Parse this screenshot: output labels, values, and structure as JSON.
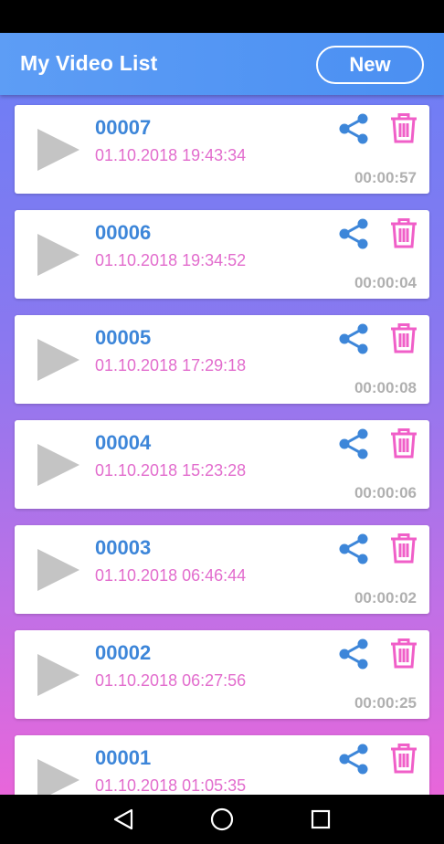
{
  "app": {
    "title": "My Video List",
    "new_label": "New"
  },
  "videos": [
    {
      "name": "00007",
      "date": "01.10.2018 19:43:34",
      "duration": "00:00:57"
    },
    {
      "name": "00006",
      "date": "01.10.2018 19:34:52",
      "duration": "00:00:04"
    },
    {
      "name": "00005",
      "date": "01.10.2018 17:29:18",
      "duration": "00:00:08"
    },
    {
      "name": "00004",
      "date": "01.10.2018 15:23:28",
      "duration": "00:00:06"
    },
    {
      "name": "00003",
      "date": "01.10.2018 06:46:44",
      "duration": "00:00:02"
    },
    {
      "name": "00002",
      "date": "01.10.2018 06:27:56",
      "duration": "00:00:25"
    },
    {
      "name": "00001",
      "date": "01.10.2018 01:05:35",
      "duration": ""
    }
  ],
  "icons": {
    "play": "play-icon",
    "share": "share-icon",
    "delete": "trash-icon",
    "nav_back": "back-icon",
    "nav_home": "home-icon",
    "nav_recents": "recents-icon"
  },
  "colors": {
    "app_bar": "#4a8ff2",
    "name": "#3d86d9",
    "date": "#e26ccd",
    "duration": "#b0b0b0",
    "share": "#3d86d9",
    "delete": "#f05fc8"
  }
}
